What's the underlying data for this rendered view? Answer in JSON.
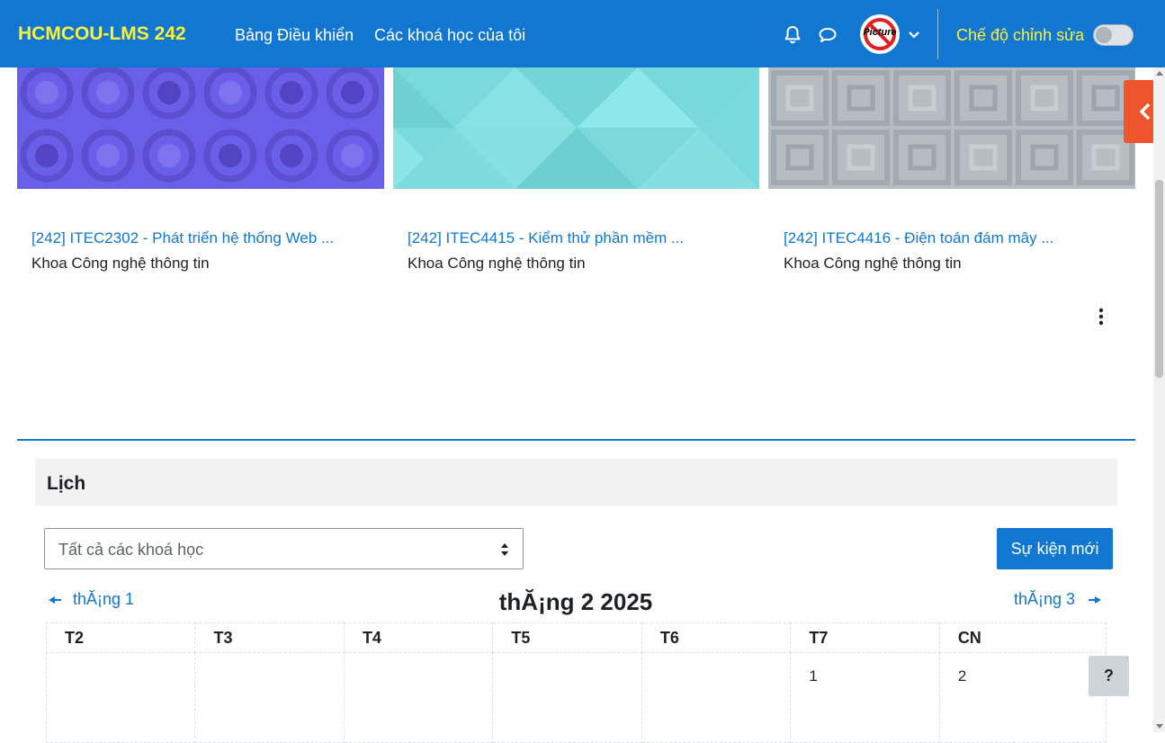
{
  "navbar": {
    "brand": "HCMCOU-LMS 242",
    "links": [
      "Bảng Điều khiển",
      "Các khoá học của tôi"
    ],
    "avatar_text": "Picture",
    "edit_mode_label": "Chế độ chỉnh sửa",
    "edit_mode_on": false,
    "icons": [
      "bell-icon",
      "chat-icon",
      "chevron-down-icon"
    ],
    "colors": {
      "bar": "#1177d1",
      "brand": "#fcf03a",
      "edit_label": "#fcf03a"
    }
  },
  "courses": [
    {
      "title": "[242] ITEC2302 - Phát triển hệ thống Web ...",
      "category": "Khoa Công nghệ thông tin",
      "pattern": "circles",
      "color": "#6a5fe8"
    },
    {
      "title": "[242] ITEC4415 - Kiểm thử phần mềm ...",
      "category": "Khoa Công nghệ thông tin",
      "pattern": "triangles",
      "color": "#7ad9dc"
    },
    {
      "title": "[242] ITEC4416 - Điện toán đám mây ...",
      "category": "Khoa Công nghệ thông tin",
      "pattern": "squares",
      "color": "#b5bcc2"
    }
  ],
  "calendar": {
    "block_title": "Lịch",
    "course_filter": "Tất cả các khoá học",
    "new_event_label": "Sự kiện mới",
    "prev_month": "thĂ¡ng 1",
    "next_month": "thĂ¡ng 3",
    "month_title": "thĂ¡ng 2 2025",
    "weekdays": [
      "T2",
      "T3",
      "T4",
      "T5",
      "T6",
      "T7",
      "CN"
    ],
    "first_week": [
      "",
      "",
      "",
      "",
      "",
      "1",
      "2"
    ]
  },
  "help_label": "?",
  "accent_colors": {
    "link": "#1177d1",
    "drawer_toggle": "#f0542c"
  }
}
